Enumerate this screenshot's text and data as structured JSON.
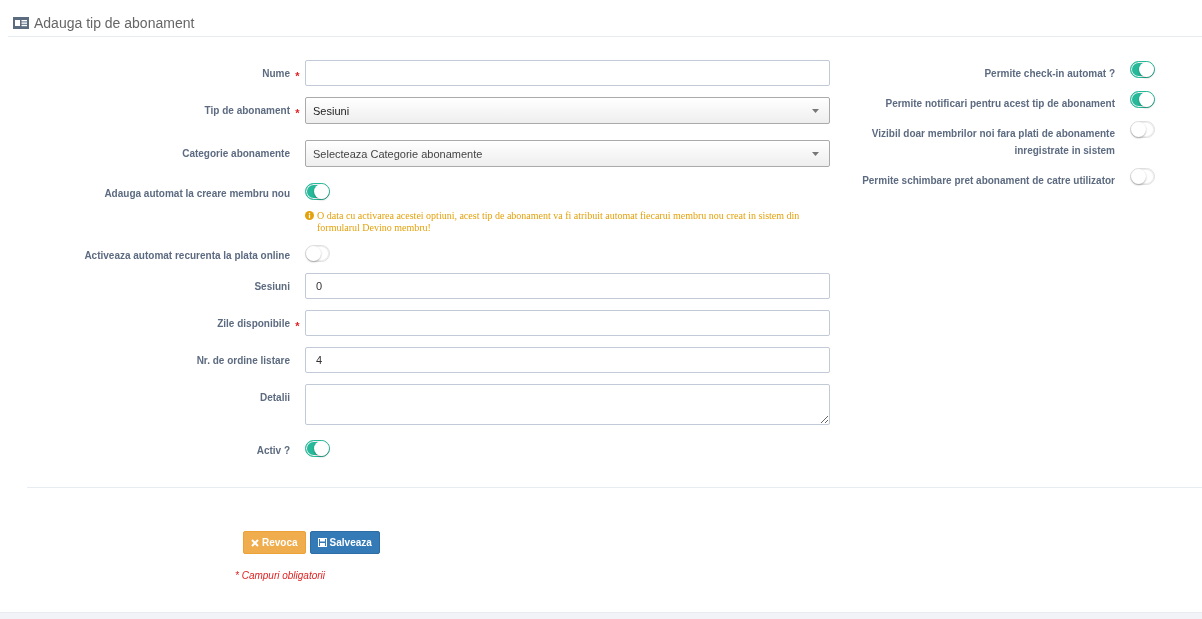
{
  "header": {
    "title": "Adauga tip de abonament"
  },
  "left_fields": [
    {
      "kind": "text",
      "label": "Nume",
      "required_mark": "*"
    },
    {
      "kind": "select",
      "label": "Tip de abonament",
      "required_mark": "*",
      "value": "Sesiuni"
    },
    {
      "kind": "select",
      "label": "Categorie abonamente",
      "placeholder": "Selecteaza Categorie abonamente"
    },
    {
      "kind": "toggle",
      "label": "Adauga automat la creare membru nou",
      "on": true,
      "hint": "O data cu activarea acestei optiuni, acest tip de abonament va fi atribuit automat fiecarui membru nou creat in sistem din formularul Devino membru!"
    },
    {
      "kind": "toggle",
      "label": "Activeaza automat recurenta la plata online",
      "on": false
    },
    {
      "kind": "text",
      "label": "Sesiuni",
      "value": "0"
    },
    {
      "kind": "text",
      "label": "Zile disponibile",
      "required_mark": "*"
    },
    {
      "kind": "text",
      "label": "Nr. de ordine listare",
      "value": "4"
    },
    {
      "kind": "textarea",
      "label": "Detalii"
    },
    {
      "kind": "toggle",
      "label": "Activ ?",
      "on": true
    }
  ],
  "right_toggles": [
    {
      "label": "Permite check-in automat ?",
      "on": true
    },
    {
      "label": "Permite notificari pentru acest tip de abonament",
      "on": true
    },
    {
      "label": "Vizibil doar membrilor noi fara plati de abonamente inregistrate in sistem",
      "on": false
    },
    {
      "label": "Permite schimbare pret abonament de catre utilizator",
      "on": false
    }
  ],
  "buttons": [
    {
      "kind": "cancel",
      "label": "Revoca"
    },
    {
      "kind": "save",
      "label": "Salveaza"
    }
  ],
  "required_note": "* Campuri obligatorii"
}
